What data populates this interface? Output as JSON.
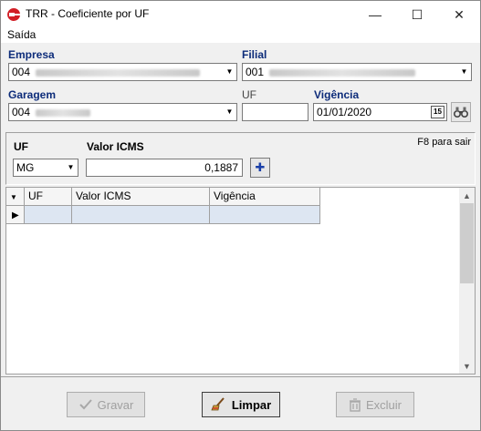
{
  "window": {
    "title": "TRR - Coeficiente por UF",
    "minimize_glyph": "—",
    "maximize_glyph": "☐",
    "close_glyph": "✕"
  },
  "menu": {
    "items": [
      {
        "label": "Saída"
      }
    ]
  },
  "filters": {
    "empresa_label": "Empresa",
    "empresa_value": "004",
    "filial_label": "Filial",
    "filial_value": "001",
    "garagem_label": "Garagem",
    "garagem_value": "004",
    "uf_label": "UF",
    "uf_value": "",
    "vigencia_label": "Vigência",
    "vigencia_value": "01/01/2020",
    "calendar_glyph": "15"
  },
  "entry": {
    "uf_label": "UF",
    "uf_value": "MG",
    "valor_label": "Valor ICMS",
    "valor_value": "0,1887",
    "f8_hint": "F8 para sair",
    "add_glyph": "✚"
  },
  "grid": {
    "columns": [
      "UF",
      "Valor ICMS",
      "Vigência"
    ],
    "rows": [
      {
        "uf": "",
        "valor_icms": "",
        "vigencia": ""
      }
    ]
  },
  "actions": {
    "gravar_label": "Gravar",
    "limpar_label": "Limpar",
    "excluir_label": "Excluir"
  },
  "colors": {
    "label_blue": "#0d2c7a",
    "logo_red": "#d21f26",
    "selected_row": "#dde6f2"
  }
}
